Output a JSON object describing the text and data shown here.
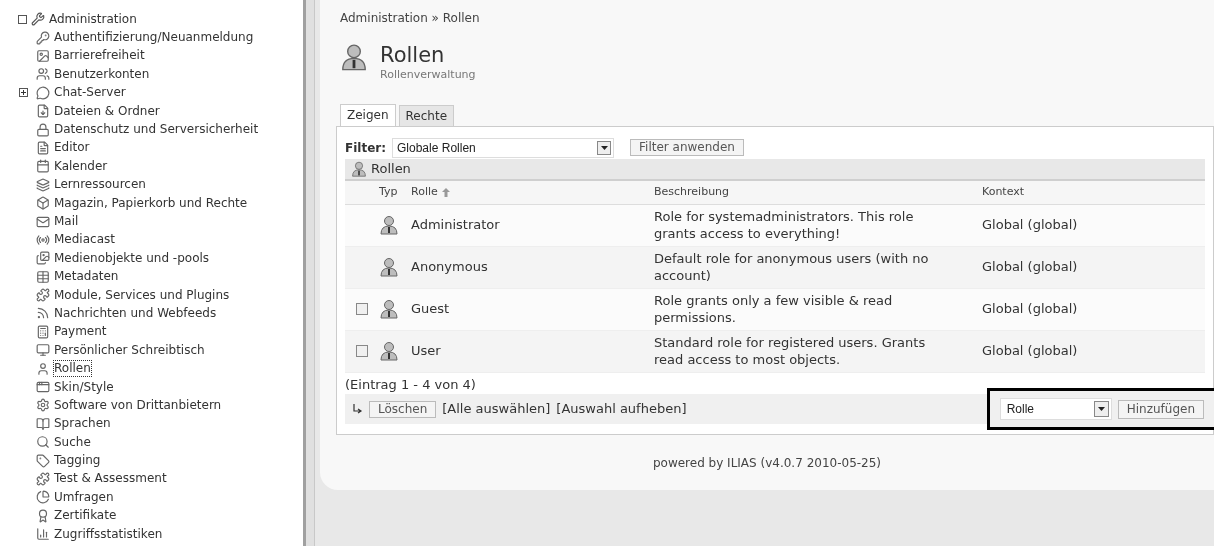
{
  "sidebar": {
    "tree": {
      "label": "Administration",
      "expanded": true,
      "children": [
        {
          "label": "Authentifizierung/Neuanmeldung",
          "selected": false
        },
        {
          "label": "Barrierefreiheit",
          "selected": false
        },
        {
          "label": "Benutzerkonten",
          "selected": false
        },
        {
          "label": "Chat-Server",
          "selected": false,
          "expanded": false
        },
        {
          "label": "Dateien & Ordner",
          "selected": false
        },
        {
          "label": "Datenschutz und Serversicherheit",
          "selected": false
        },
        {
          "label": "Editor",
          "selected": false
        },
        {
          "label": "Kalender",
          "selected": false
        },
        {
          "label": "Lernressourcen",
          "selected": false
        },
        {
          "label": "Magazin, Papierkorb und Rechte",
          "selected": false
        },
        {
          "label": "Mail",
          "selected": false
        },
        {
          "label": "Mediacast",
          "selected": false
        },
        {
          "label": "Medienobjekte und -pools",
          "selected": false
        },
        {
          "label": "Metadaten",
          "selected": false
        },
        {
          "label": "Module, Services und Plugins",
          "selected": false
        },
        {
          "label": "Nachrichten und Webfeeds",
          "selected": false
        },
        {
          "label": "Payment",
          "selected": false
        },
        {
          "label": "Persönlicher Schreibtisch",
          "selected": false
        },
        {
          "label": "Rollen",
          "selected": true
        },
        {
          "label": "Skin/Style",
          "selected": false
        },
        {
          "label": "Software von Drittanbietern",
          "selected": false
        },
        {
          "label": "Sprachen",
          "selected": false
        },
        {
          "label": "Suche",
          "selected": false
        },
        {
          "label": "Tagging",
          "selected": false
        },
        {
          "label": "Test & Assessment",
          "selected": false
        },
        {
          "label": "Umfragen",
          "selected": false
        },
        {
          "label": "Zertifikate",
          "selected": false
        },
        {
          "label": "Zugriffsstatistiken",
          "selected": false
        }
      ]
    }
  },
  "breadcrumb": "Administration » Rollen",
  "header": {
    "title": "Rollen",
    "subtitle": "Rollenverwaltung"
  },
  "tabs": [
    {
      "label": "Zeigen",
      "selected": true
    },
    {
      "label": "Rechte",
      "selected": false
    }
  ],
  "filter": {
    "label": "Filter:",
    "value": "Globale Rollen",
    "button": "Filter anwenden"
  },
  "table": {
    "title": "Rollen",
    "columns": [
      "Typ",
      "Rolle",
      "Beschreibung",
      "Kontext"
    ],
    "rows": [
      {
        "role": "Administrator",
        "description": "Role for systemadministrators. This role grants access to everything!",
        "context": "Global (global)"
      },
      {
        "role": "Anonymous",
        "description": "Default role for anonymous users (with no account)",
        "context": "Global (global)"
      },
      {
        "checked": false,
        "role": "Guest",
        "description": "Role grants only a few visible & read permissions.",
        "context": "Global (global)"
      },
      {
        "checked": false,
        "role": "User",
        "description": "Standard role for registered users. Grants read access to most objects.",
        "context": "Global (global)"
      }
    ],
    "count": "(Eintrag 1 - 4 von 4)",
    "delete_button": "Löschen",
    "links": [
      "[Alle auswählen]",
      "[Auswahl aufheben]"
    ],
    "add_select": "Rolle",
    "add_button": "Hinzufügen"
  },
  "footer": "powered by ILIAS (v4.0.7 2010-05-25)"
}
